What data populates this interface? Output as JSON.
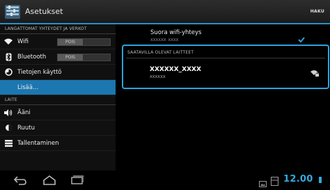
{
  "actionbar": {
    "title": "Asetukset",
    "search_label": "HAKU"
  },
  "sidebar": {
    "wireless_header": "LANGATTOMAT YHTEYDET JA VERKOT",
    "device_header": "LAITE",
    "items": [
      {
        "label": "Wifi",
        "icon": "wifi-icon",
        "toggle": "POIS"
      },
      {
        "label": "Bluetooth",
        "icon": "bluetooth-icon",
        "toggle": "POIS"
      },
      {
        "label": "Tietojen käyttö",
        "icon": "data-usage-icon"
      },
      {
        "label": "Lisää...",
        "active": true
      },
      {
        "label": "Ääni",
        "icon": "sound-icon"
      },
      {
        "label": "Ruutu",
        "icon": "display-icon"
      },
      {
        "label": "Tallentaminen",
        "icon": "storage-icon"
      }
    ]
  },
  "main": {
    "wifi_direct": {
      "title": "Suora wifi-yhteys",
      "subtitle": "XXXXXX_XXXX",
      "checked": true
    },
    "available_devices": {
      "header": "SAATAVILLA OLEVAT LAITTEET",
      "devices": [
        {
          "name": "XXXXXX_XXXX",
          "status": "XXXXXX",
          "icon": "wifi-signal-lock-icon"
        }
      ]
    }
  },
  "systembar": {
    "clock": "12.00",
    "accent_color": "#35a8df"
  },
  "colors": {
    "accent": "#2da2e0",
    "selected_bg": "#1c77b0"
  }
}
